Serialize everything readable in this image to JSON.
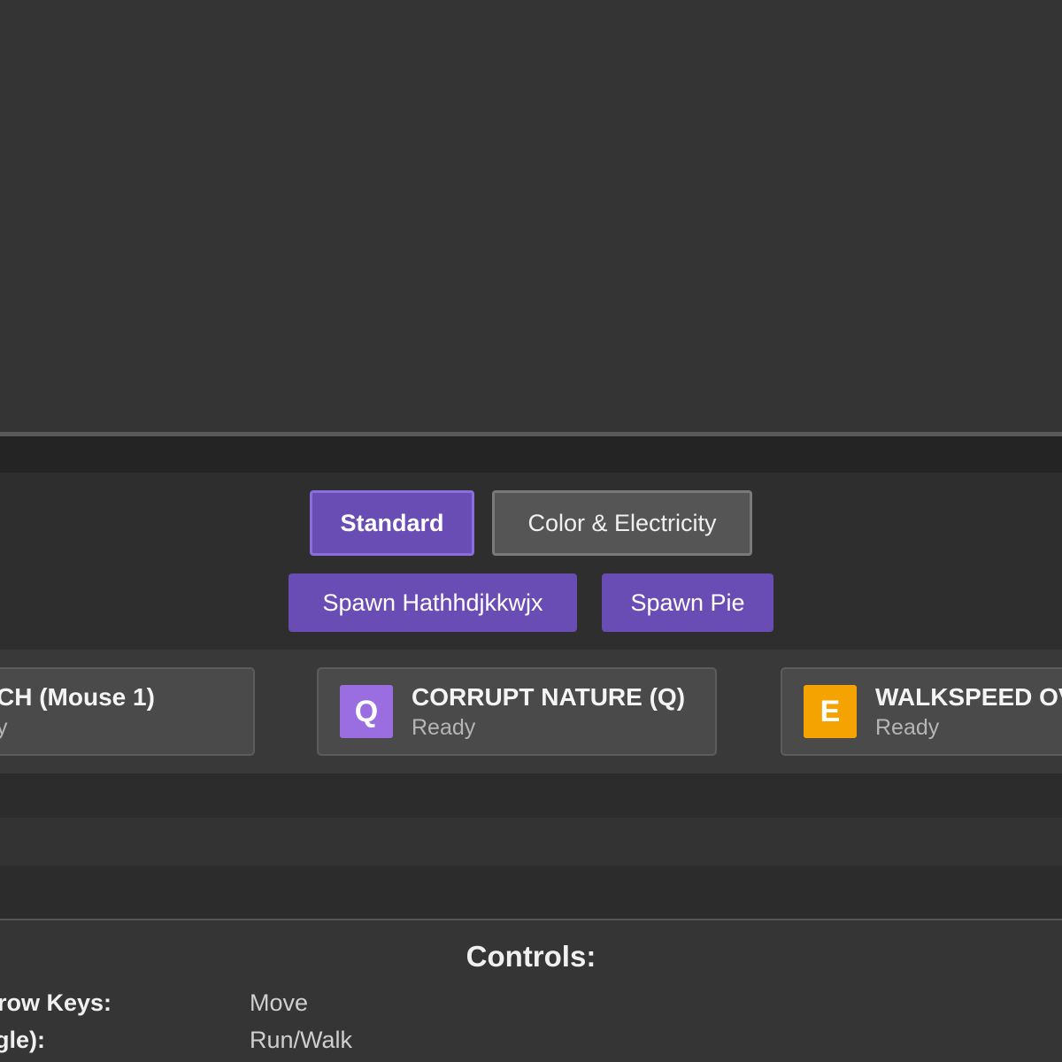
{
  "mode_selector": {
    "modes": [
      {
        "label": "Standard",
        "active": true
      },
      {
        "label": "Color & Electricity",
        "active": false
      }
    ]
  },
  "spawn_buttons": [
    {
      "label": "Spawn Hathhdjkkwjx"
    },
    {
      "label": "Spawn Pie"
    }
  ],
  "abilities": [
    {
      "key": "",
      "name": "CH (Mouse 1)",
      "status": "y",
      "icon": "none",
      "color": "#4a4a4a"
    },
    {
      "key": "Q",
      "name": "CORRUPT NATURE (Q)",
      "status": "Ready",
      "icon": "key-q-icon",
      "color": "#9a6ee0"
    },
    {
      "key": "E",
      "name": "WALKSPEED OV",
      "status": "Ready",
      "icon": "key-e-icon",
      "color": "#f5a300"
    }
  ],
  "controls": {
    "title": "Controls:",
    "rows": [
      {
        "key": "row Keys:",
        "action": "Move"
      },
      {
        "key": "gle):",
        "action": "Run/Walk"
      }
    ]
  },
  "colors": {
    "accent_purple": "#6a4cb5",
    "accent_orange": "#f5a300",
    "background": "#333333"
  }
}
